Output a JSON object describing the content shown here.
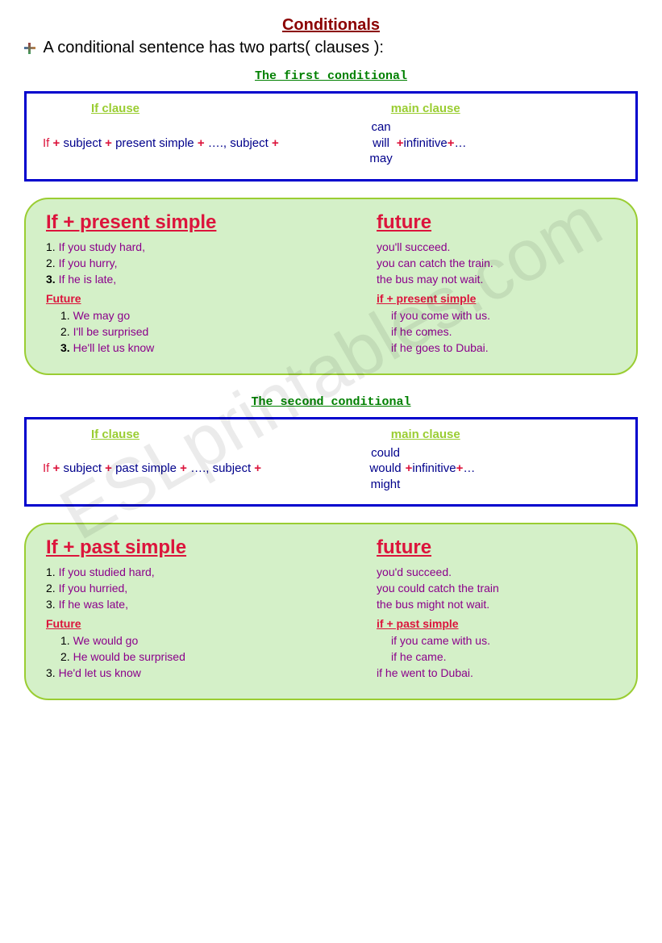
{
  "title": "Conditionals",
  "intro": "A conditional sentence has two parts( clauses ):",
  "watermark": "ESLprintables.com",
  "section1": {
    "heading": "The first conditional",
    "formula": {
      "if_clause_label": " If clause",
      "main_clause_label": "main clause",
      "if": "If",
      "subject": "subject",
      "tense": "present simple",
      "ellipsis": "….,",
      "subject2": "subject",
      "modals": [
        "can",
        "will",
        "may"
      ],
      "infinitive": "infinitive",
      "trail": "…"
    },
    "examples": {
      "head_left": "If + present simple",
      "head_right": "future",
      "rows1": [
        {
          "n": "1.",
          "l": "If you study hard,",
          "r": "you'll succeed."
        },
        {
          "n": "2.",
          "l": "If you hurry,",
          "r": "you can catch the train."
        },
        {
          "n": "3.",
          "l": "If he is late,",
          "r": "the bus may not wait."
        }
      ],
      "sub_left": "Future",
      "sub_right": "if + present simple",
      "rows2": [
        {
          "n": "1.",
          "l": "We may go",
          "r": "if you come with us."
        },
        {
          "n": "2.",
          "l": "I'll be surprised",
          "r": "if he comes."
        },
        {
          "n": "3.",
          "l": "He'll let us know",
          "r": "if he goes to Dubai."
        }
      ]
    }
  },
  "section2": {
    "heading": "The second conditional",
    "formula": {
      "if_clause_label": " If clause",
      "main_clause_label": "main clause",
      "if": "If",
      "subject": "subject",
      "tense": "past simple",
      "ellipsis": "….,",
      "subject2": "subject",
      "modals": [
        "could",
        "would",
        "might"
      ],
      "infinitive": "infinitive",
      "trail": "…"
    },
    "examples": {
      "head_left": "If + past simple",
      "head_right": "future",
      "rows1": [
        {
          "n": "1.",
          "l": "If you studied hard,",
          "r": "you'd succeed."
        },
        {
          "n": "2.",
          "l": "If you hurried,",
          "r": "you could catch the train"
        },
        {
          "n": "3.",
          "l": "If he was late,",
          "r": "the bus might not wait."
        }
      ],
      "sub_left": "Future",
      "sub_right": "if + past simple",
      "rows2": [
        {
          "n": "1.",
          "l": "We would go",
          "r": "if you came with us."
        },
        {
          "n": "2.",
          "l": "He would be surprised",
          "r": "if he came."
        },
        {
          "n": "3.",
          "l": "He'd let us know",
          "r": "if he went to Dubai."
        }
      ]
    }
  }
}
